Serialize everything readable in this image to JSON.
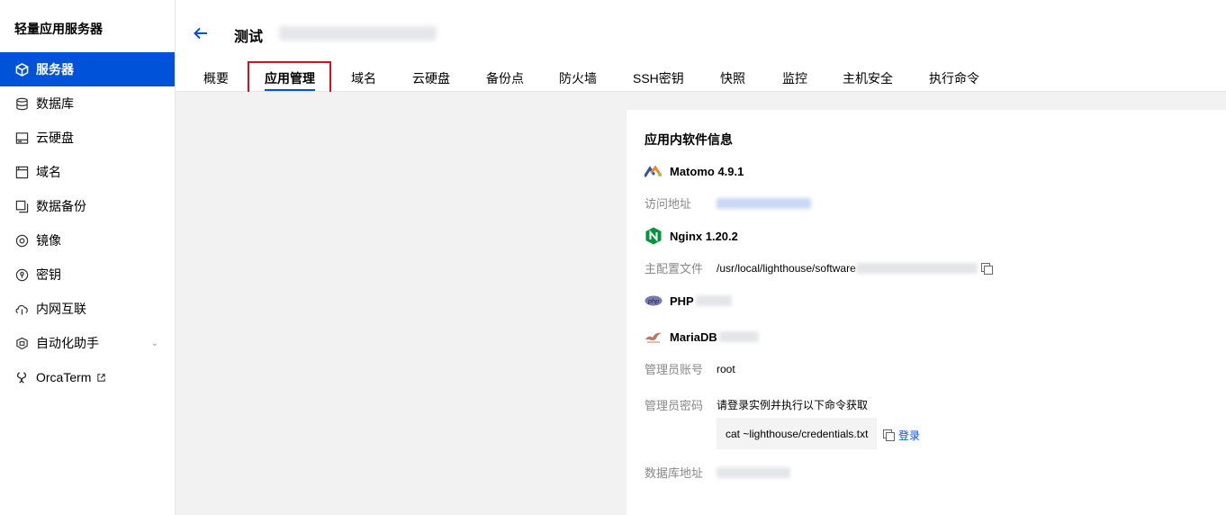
{
  "sidebar": {
    "brand": "轻量应用服务器",
    "items": [
      {
        "label": "服务器",
        "icon": "server-icon",
        "active": true
      },
      {
        "label": "数据库",
        "icon": "database-icon"
      },
      {
        "label": "云硬盘",
        "icon": "disk-icon"
      },
      {
        "label": "域名",
        "icon": "domain-icon"
      },
      {
        "label": "数据备份",
        "icon": "backup-icon"
      },
      {
        "label": "镜像",
        "icon": "image-icon"
      },
      {
        "label": "密钥",
        "icon": "key-icon"
      },
      {
        "label": "内网互联",
        "icon": "network-icon"
      },
      {
        "label": "自动化助手",
        "icon": "automation-icon",
        "has_chevron": true
      },
      {
        "label": "OrcaTerm",
        "icon": "terminal-icon",
        "external": true
      }
    ]
  },
  "header": {
    "title": "测试",
    "tabs": [
      "概要",
      "应用管理",
      "域名",
      "云硬盘",
      "备份点",
      "防火墙",
      "SSH密钥",
      "快照",
      "监控",
      "主机安全",
      "执行命令"
    ],
    "active_tab": "应用管理"
  },
  "panel": {
    "title": "应用内软件信息",
    "matomo": {
      "name": "Matomo 4.9.1",
      "access_label": "访问地址"
    },
    "nginx": {
      "name": "Nginx 1.20.2",
      "config_label": "主配置文件",
      "config_path": "/usr/local/lighthouse/software"
    },
    "php": {
      "name": "PHP"
    },
    "mariadb": {
      "name": "MariaDB",
      "admin_account_label": "管理员账号",
      "admin_account": "root",
      "admin_password_label": "管理员密码",
      "admin_password_hint": "请登录实例并执行以下命令获取",
      "command": "cat ~lighthouse/credentials.txt",
      "login_link": "登录",
      "db_address_label": "数据库地址"
    }
  },
  "colors": {
    "primary": "#0052d9",
    "highlight_box": "#d9101a"
  }
}
